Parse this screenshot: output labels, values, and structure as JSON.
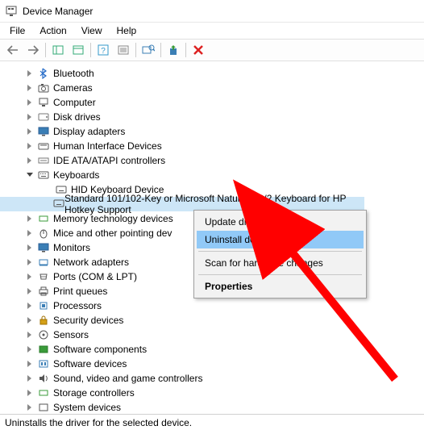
{
  "window": {
    "title": "Device Manager"
  },
  "menubar": {
    "file": "File",
    "action": "Action",
    "view": "View",
    "help": "Help"
  },
  "tree": {
    "items": [
      {
        "label": "Bluetooth",
        "expandable": true
      },
      {
        "label": "Cameras",
        "expandable": true
      },
      {
        "label": "Computer",
        "expandable": true
      },
      {
        "label": "Disk drives",
        "expandable": true
      },
      {
        "label": "Display adapters",
        "expandable": true
      },
      {
        "label": "Human Interface Devices",
        "expandable": true
      },
      {
        "label": "IDE ATA/ATAPI controllers",
        "expandable": true
      },
      {
        "label": "Keyboards",
        "expandable": true,
        "expanded": true,
        "children": [
          {
            "label": "HID Keyboard Device"
          },
          {
            "label": "Standard 101/102-Key or Microsoft Natural PS/2 Keyboard for HP Hotkey Support",
            "selected": true
          }
        ]
      },
      {
        "label": "Memory technology devices",
        "expandable": true
      },
      {
        "label": "Mice and other pointing dev",
        "expandable": true
      },
      {
        "label": "Monitors",
        "expandable": true
      },
      {
        "label": "Network adapters",
        "expandable": true
      },
      {
        "label": "Ports (COM & LPT)",
        "expandable": true
      },
      {
        "label": "Print queues",
        "expandable": true
      },
      {
        "label": "Processors",
        "expandable": true
      },
      {
        "label": "Security devices",
        "expandable": true
      },
      {
        "label": "Sensors",
        "expandable": true
      },
      {
        "label": "Software components",
        "expandable": true
      },
      {
        "label": "Software devices",
        "expandable": true
      },
      {
        "label": "Sound, video and game controllers",
        "expandable": true
      },
      {
        "label": "Storage controllers",
        "expandable": true
      },
      {
        "label": "System devices",
        "expandable": true
      }
    ]
  },
  "context_menu": {
    "update": "Update driver",
    "uninstall": "Uninstall device",
    "scan": "Scan for hardware changes",
    "properties": "Properties"
  },
  "statusbar": {
    "text": "Uninstalls the driver for the selected device."
  }
}
